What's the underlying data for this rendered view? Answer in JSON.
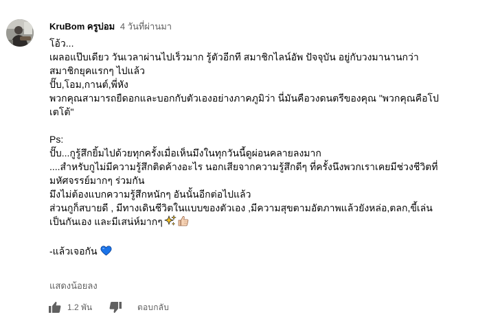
{
  "comment": {
    "author": "KruBom ครูบ่อม",
    "time": "4 วันที่ผ่านมา",
    "lines": [
      "โอ้ว...",
      "เผลอแป๊บเดียว วันเวลาผ่านไปเร็วมาก รู้ตัวอีกที สมาชิกไลน์อัพ ปัจจุบัน อยู่กับวงมานานกว่า",
      "สมาชิกยุคแรกๆ ไปแล้ว",
      "ปั๊บ,โอม,กานต์,พี่หัง",
      "พวกคุณสามารถยืดอกและบอกกับตัวเองอย่างภาคภูมิว่า นี่มันคือวงดนตรีของคุณ \"พวกคุณคือโป",
      "เตโต้\"",
      "",
      "Ps:",
      "ปั๊บ...กูรู้สึกยิ้มไปด้วยทุกครั้งเมื่อเห็นมึงในทุกวันนี้ดูผ่อนคลายลงมาก",
      "....สำหรับกูไม่มีความรู้สึกติดค้างอะไร นอกเสียจากความรู้สึกดีๆ ที่ครั้งนึงพวกเราเคยมีช่วงชีวิตที่",
      "มหัศจรรย์มากๆ ร่วมกัน",
      "มึงไม่ต้องแบกความรู้สึกหนักๆ อันนั้นอีกต่อไปแล้ว",
      "ส่วนกูก็สบายดี , มีทางเดินชีวิตในแบบของตัวเอง ,มีความสุขตามอัตภาพแล้วยังหล่อ,ตลก,ขี้เล่น",
      "เป็นกันเอง และมีเสน่ห์มากๆ",
      "",
      "-แล้วเจอกัน"
    ],
    "emoji_after_line_13": [
      "sparkles-icon",
      "thumbs-up-icon"
    ],
    "emoji_after_line_15": [
      "blue-heart-icon"
    ],
    "show_less": "แสดงน้อยลง",
    "like_count": "1.2 พัน",
    "reply_label": "ตอบกลับ"
  },
  "colors": {
    "text": "#030303",
    "secondary": "#606060",
    "heart": "#1a73e8",
    "sparkle": "#f7c325"
  }
}
